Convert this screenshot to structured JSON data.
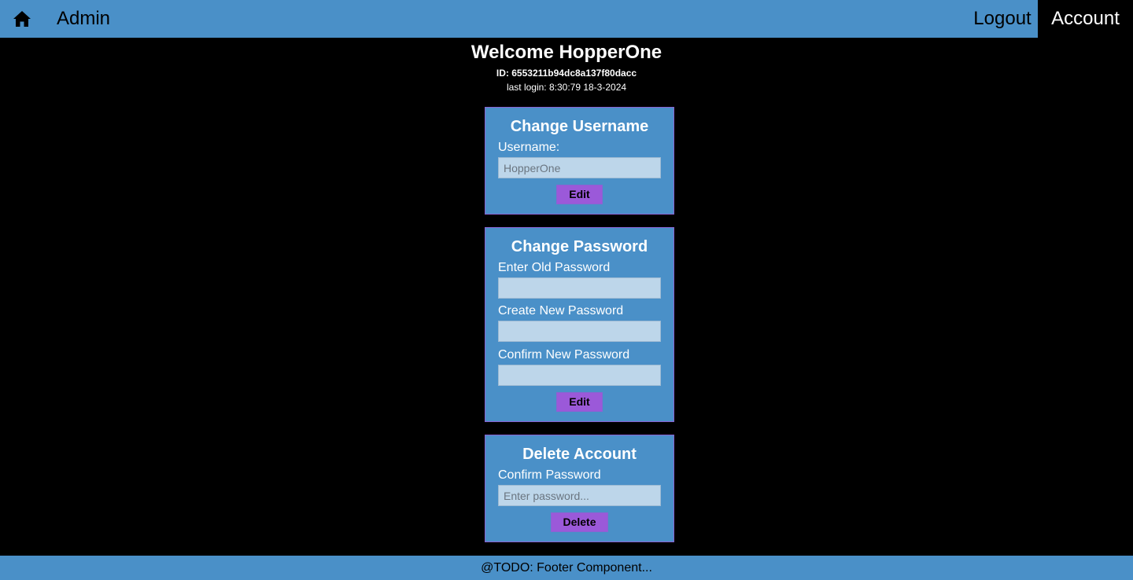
{
  "nav": {
    "home_icon": "home-icon",
    "admin_label": "Admin",
    "logout_label": "Logout",
    "account_label": "Account"
  },
  "header": {
    "welcome": "Welcome HopperOne",
    "user_id": "ID: 6553211b94dc8a137f80dacc",
    "last_login": "last login: 8:30:79 18-3-2024"
  },
  "change_username": {
    "title": "Change Username",
    "username_label": "Username:",
    "username_placeholder": "HopperOne",
    "button_label": "Edit"
  },
  "change_password": {
    "title": "Change Password",
    "old_label": "Enter Old Password",
    "new_label": "Create New Password",
    "confirm_label": "Confirm New Password",
    "button_label": "Edit"
  },
  "delete_account": {
    "title": "Delete Account",
    "confirm_label": "Confirm Password",
    "confirm_placeholder": "Enter password...",
    "button_label": "Delete"
  },
  "footer": {
    "text": "@TODO: Footer Component..."
  },
  "colors": {
    "primary": "#4a90c8",
    "background": "#000000",
    "button": "#9b59d9",
    "input": "#bdd6ea"
  }
}
